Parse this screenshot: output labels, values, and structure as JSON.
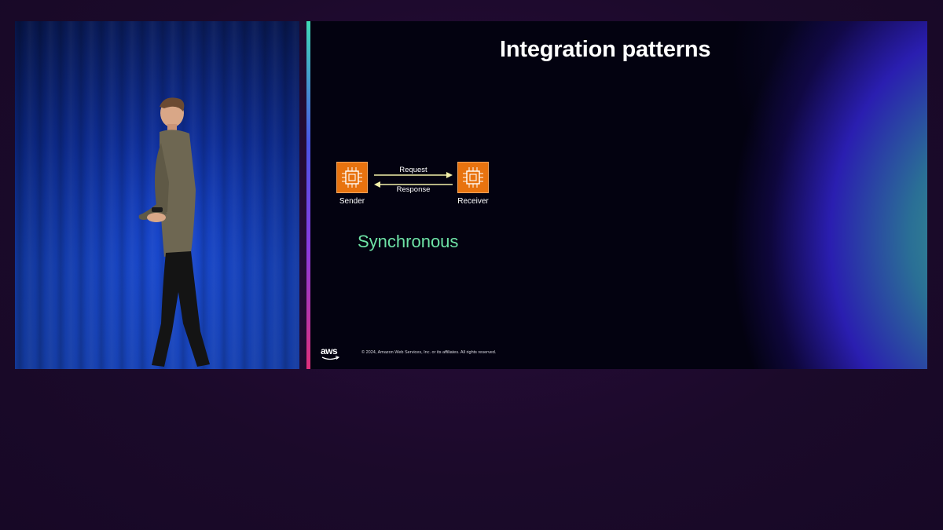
{
  "slide": {
    "title": "Integration patterns",
    "sender_label": "Sender",
    "receiver_label": "Receiver",
    "request_label": "Request",
    "response_label": "Response",
    "pattern_label": "Synchronous",
    "copyright": "© 2024, Amazon Web Services, Inc. or its affiliates. All rights reserved.",
    "logo_text": "aws",
    "node_icon": "compute-chip-icon"
  },
  "colors": {
    "node_fill": "#e8730f",
    "pattern_label": "#6ee3a6",
    "arrow": "#f2f0a8",
    "accent_bar_top": "#3fd9b5",
    "accent_bar_bottom": "#e0307a",
    "background": "#1e0a2e"
  }
}
